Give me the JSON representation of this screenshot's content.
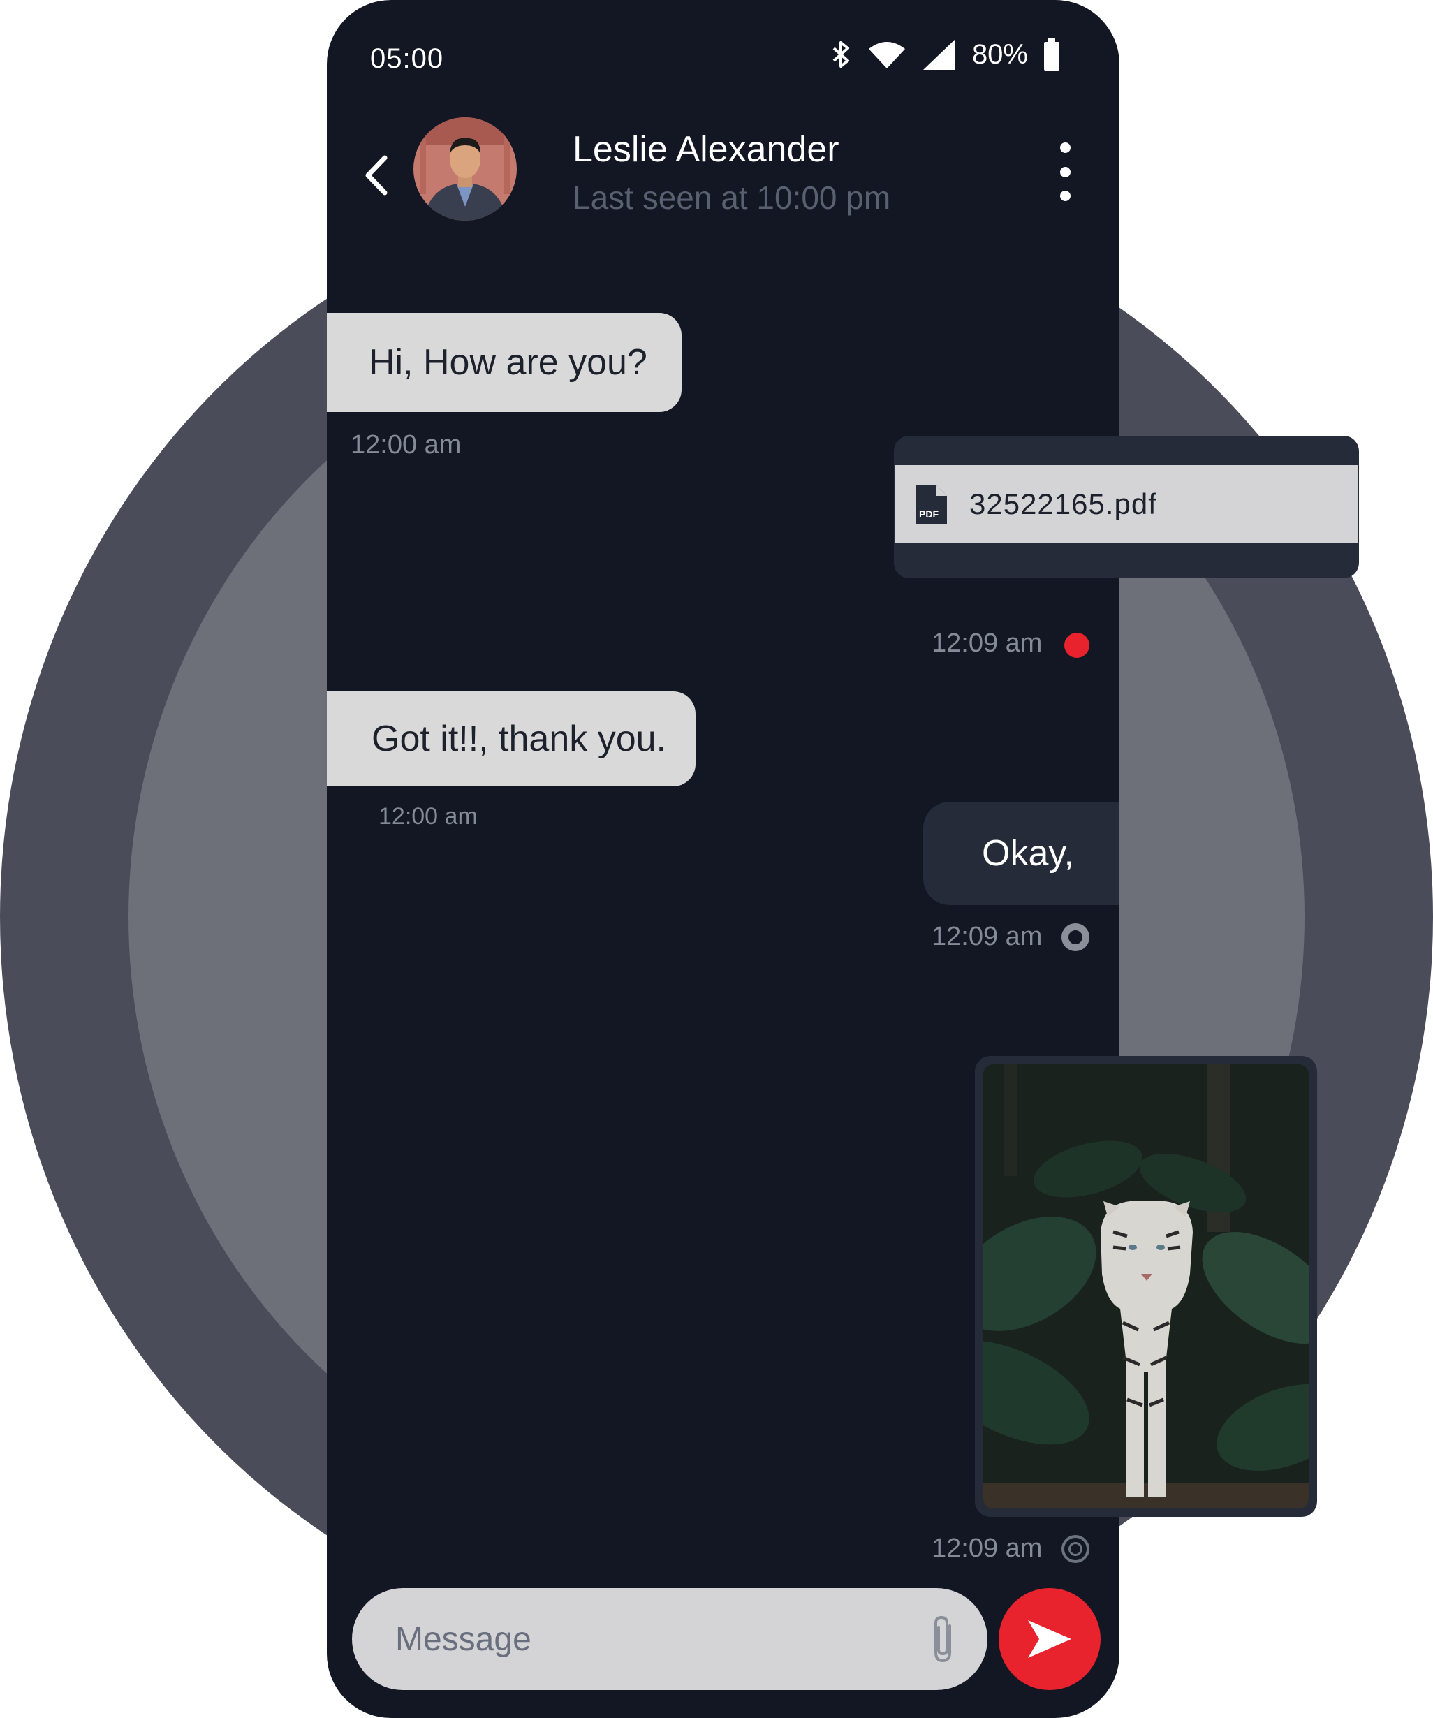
{
  "status_bar": {
    "time": "05:00",
    "battery_percent": "80%",
    "icons": [
      "bluetooth-icon",
      "wifi-icon",
      "signal-icon",
      "battery-icon"
    ]
  },
  "contact": {
    "name": "Leslie Alexander",
    "last_seen": "Last seen at 10:00 pm",
    "avatar": "avatar-photo"
  },
  "messages": [
    {
      "direction": "incoming",
      "type": "text",
      "text": "Hi, How are you?",
      "time": "12:00 am"
    },
    {
      "direction": "outgoing",
      "type": "file",
      "file_name": "32522165.pdf",
      "file_icon_label": "PDF",
      "time": "12:09 am",
      "status": "unread"
    },
    {
      "direction": "incoming",
      "type": "text",
      "text": "Got it!!, thank you.",
      "time": "12:00 am"
    },
    {
      "direction": "outgoing",
      "type": "text",
      "text": "Okay,",
      "time": "12:09 am",
      "status": "delivered"
    },
    {
      "direction": "outgoing",
      "type": "image",
      "image": "white tiger photo",
      "time": "12:09 am",
      "status": "sent"
    }
  ],
  "composer": {
    "placeholder": "Message",
    "value": ""
  },
  "colors": {
    "background": "#121723",
    "accent": "#e8232e",
    "incoming_bubble": "#d9d9d9",
    "outgoing_bubble": "#262b39",
    "ring_outer": "#4a4d59",
    "ring_inner": "#6d6f79"
  }
}
